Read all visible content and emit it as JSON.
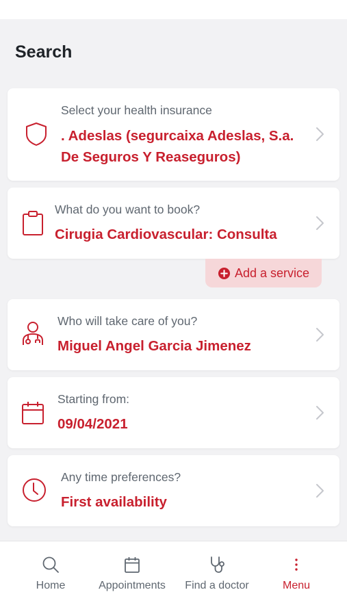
{
  "page": {
    "title": "Search"
  },
  "colors": {
    "accent": "#c8202e",
    "label": "#5f6770",
    "background": "#f2f2f4"
  },
  "cards": {
    "insurance": {
      "label": "Select your health insurance",
      "value_line1": ". Adeslas (segurcaixa Adeslas, S.a.",
      "value_line2": "De Seguros Y Reaseguros)",
      "icon": "shield-icon"
    },
    "service": {
      "label": "What do you want to book?",
      "value": "Cirugia Cardiovascular: Consulta",
      "icon": "clipboard-icon"
    },
    "doctor": {
      "label": "Who will take care of you?",
      "value": "Miguel Angel Garcia Jimenez",
      "icon": "doctor-icon"
    },
    "date": {
      "label": "Starting from:",
      "value": "09/04/2021",
      "icon": "calendar-icon"
    },
    "time": {
      "label": "Any time preferences?",
      "value": "First availability",
      "icon": "clock-icon"
    }
  },
  "add_service": {
    "label": "Add a service",
    "icon": "plus-circle-icon"
  },
  "nav": {
    "home": {
      "label": "Home",
      "icon": "search-icon"
    },
    "appointments": {
      "label": "Appointments",
      "icon": "calendar-icon"
    },
    "find_doctor": {
      "label": "Find a doctor",
      "icon": "stethoscope-icon"
    },
    "menu": {
      "label": "Menu",
      "icon": "more-vertical-icon",
      "active": true
    }
  }
}
